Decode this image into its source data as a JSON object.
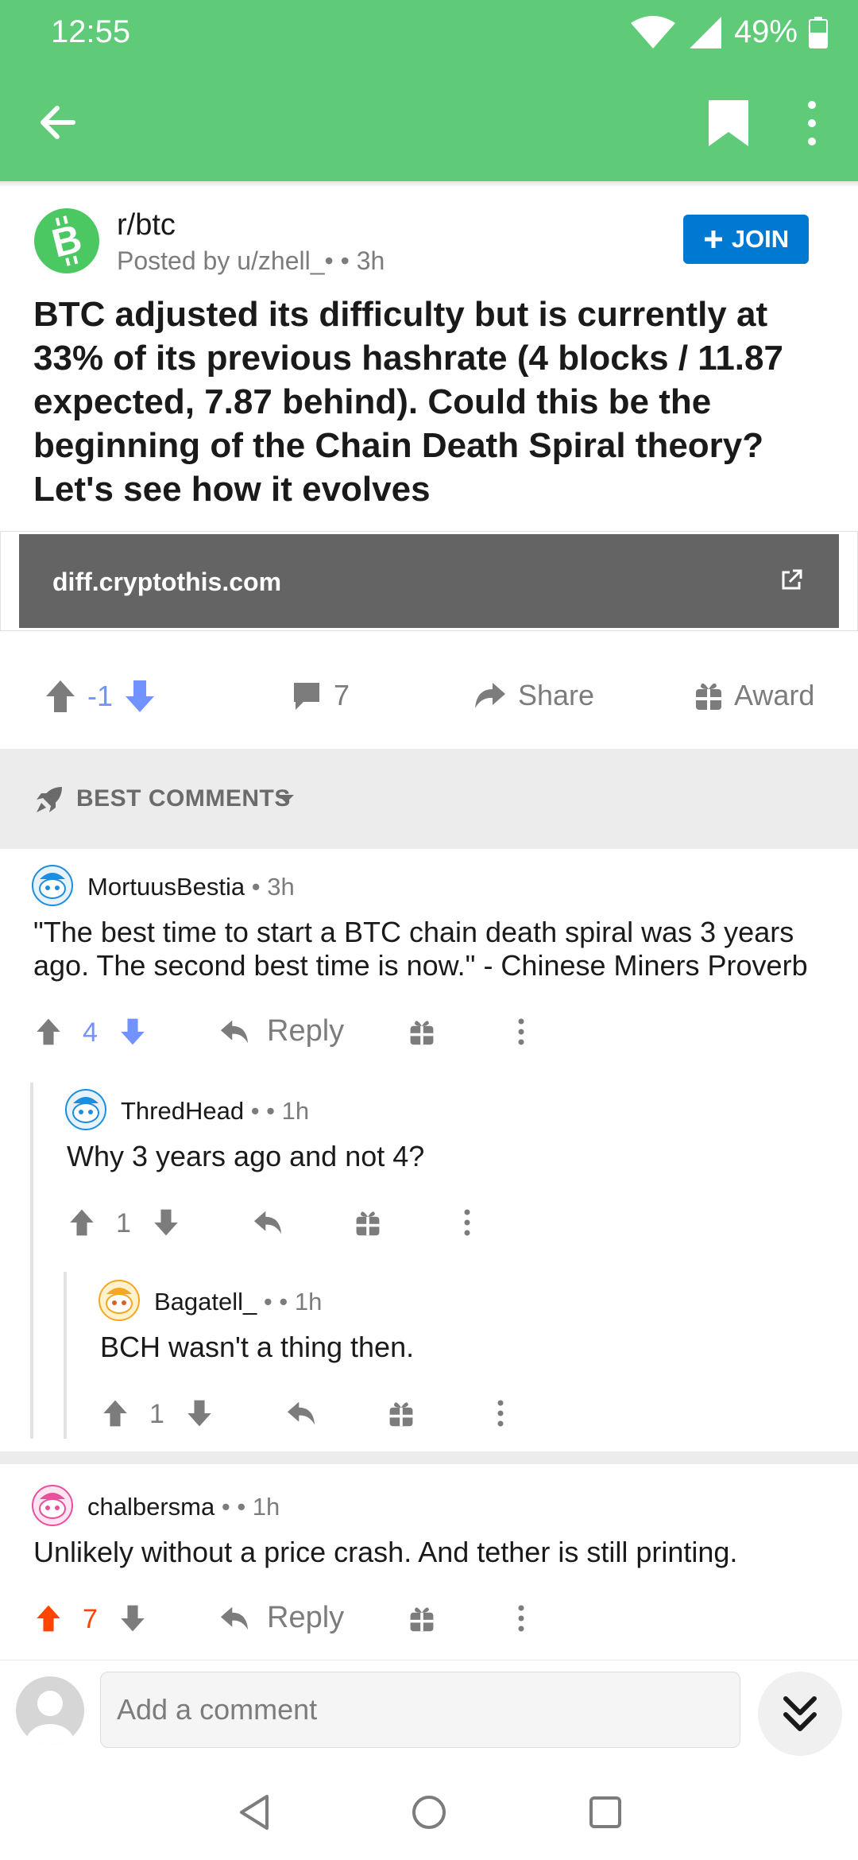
{
  "status": {
    "time": "12:55",
    "battery": "49%"
  },
  "appbar": {
    "back_icon": "arrow-left-icon",
    "save_icon": "bookmark-icon",
    "more_icon": "more-vertical-icon"
  },
  "post": {
    "subreddit": "r/btc",
    "posted_by": "Posted by u/zhell_• • 3h",
    "join_label": "JOIN",
    "title": "BTC adjusted its difficulty but is currently at 33% of its previous hashrate (4 blocks / 11.87 expected, 7.87 behind). Could this be the beginning of the Chain Death Spiral theory? Let's see how it evolves",
    "link": "diff.cryptothis.com",
    "score": "-1",
    "comments": "7",
    "share_label": "Share",
    "award_label": "Award"
  },
  "sort": {
    "label": "BEST COMMENTS"
  },
  "comments": [
    {
      "author": "MortuusBestia",
      "meta": " • 3h",
      "body": "\"The best time to start a BTC chain death spiral was 3 years ago. The second best time is now.\" - Chinese Miners Proverb",
      "score": "4",
      "reply_label": "Reply"
    },
    {
      "author": "ThredHead",
      "meta": " • • 1h",
      "body": "Why 3 years ago and not 4?",
      "score": "1"
    },
    {
      "author": "Bagatell_",
      "meta": " • • 1h",
      "body": "BCH wasn't a thing then.",
      "score": "1"
    },
    {
      "author": "chalbersma",
      "meta": " • • 1h",
      "body": "Unlikely without a price crash. And tether is still printing.",
      "score": "7",
      "reply_label": "Reply"
    }
  ],
  "comment_bar": {
    "placeholder": "Add a comment"
  },
  "colors": {
    "header": "#5fcb78",
    "join": "#0079d3",
    "upvote": "#ff4500",
    "downvote": "#7193ff"
  }
}
